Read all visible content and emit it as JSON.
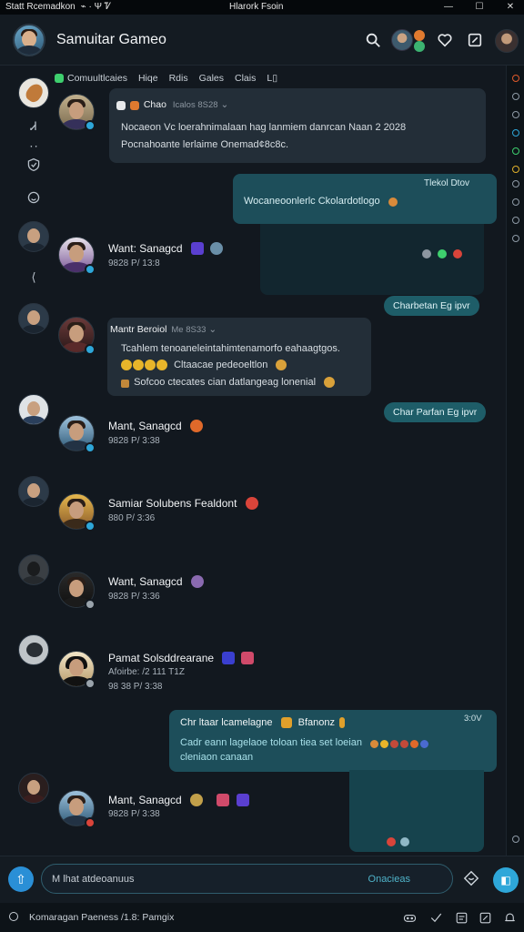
{
  "statusbar": {
    "left_text": "Statt Rcemadkon",
    "center_text": "Hlarork Fsoin",
    "glyphs": "⌁  ·  Ψ  Ꮴ"
  },
  "header": {
    "title": "Samuitar Gameo",
    "icons": [
      "search-icon",
      "heart-icon",
      "edit-icon"
    ]
  },
  "tabs": [
    "Comuultlcaies",
    "Hiqe",
    "Rdis",
    "Gales",
    "Clais",
    "L▯"
  ],
  "rail_glyphs": [
    "Ꮧ",
    "ꞏ ꞏ",
    "⟨"
  ],
  "messages": [
    {
      "id": "m1",
      "header": "Chao",
      "meta": "Icalos 8S28",
      "line1": "Nocaeon Vc loerahnimalaan hag lanmiem danrcan Naan 2 2028",
      "line2": "Pocnahoante lerlaime Onemad¢8c8c."
    },
    {
      "id": "m2",
      "header": "Tlekol Dtov",
      "line1": "Wocaneoonlerlc Ckolardotlogo"
    },
    {
      "id": "m3",
      "name": "Want: Sanagcd",
      "meta": "9828 P/ 13:8"
    },
    {
      "id": "pill1",
      "text": "Charbetan Eg ipvr"
    },
    {
      "id": "m4",
      "header": "Mantr Beroiol",
      "meta": "Me 8S33",
      "line1": "Tcahlem tenoaneleintahimtenamorfo eahaagtgos.",
      "line2": "Cltaacae pedeoeltlon",
      "line3": "Sofcoo ctecates cian datlangeag lonenial"
    },
    {
      "id": "pill2",
      "text": "Char Parfan Eg ipvr"
    },
    {
      "id": "m5",
      "name": "Mant, Sanagcd",
      "meta": "9828 P/ 3:38"
    },
    {
      "id": "m6",
      "name": "Samiar Solubens Fealdont",
      "meta": "880 P/ 3:36"
    },
    {
      "id": "m7",
      "name": "Want, Sanagcd",
      "meta": "9828 P/ 3:36"
    },
    {
      "id": "m8",
      "name": "Pamat Solsddrearane",
      "meta2": "Afoirbe: /2 111 T1Z",
      "meta": "98 38 P/ 3:38"
    },
    {
      "id": "m9",
      "header": "Chr ltaar lcamelagne",
      "tag": "Bfanonz",
      "time": "3:0V",
      "line1": "Cadr eann lagelaoe toloan tiea set loeian",
      "line2": "cleniaon canaan"
    },
    {
      "id": "m10",
      "name": "Mant, Sanagcd",
      "meta": "9828 P/ 3:38"
    }
  ],
  "composer": {
    "placeholder": "M lhat atdeoanuus",
    "hint": "Onacieas"
  },
  "footer": {
    "text": "Komaragan Paeness /1.8: Pamgix"
  },
  "colors": {
    "accent": "#2ea7d9",
    "bubble_teal": "#1d4e5a",
    "bubble_dark": "#232e38",
    "online": "#3ecf6e"
  }
}
